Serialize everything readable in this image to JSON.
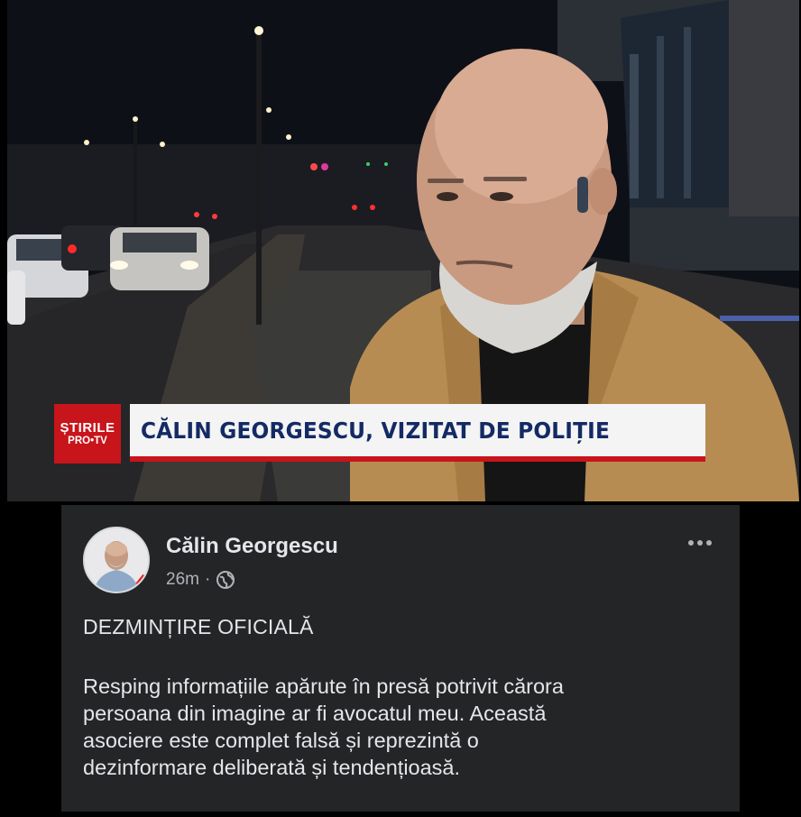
{
  "news": {
    "brand_line1": "ȘTIRILE",
    "brand_line2": "PRO•TV",
    "headline": "CĂLIN GEORGESCU, VIZITAT DE POLIȚIE",
    "brand_color": "#c8141b",
    "headline_color": "#142a64"
  },
  "post": {
    "author": "Călin Georgescu",
    "time": "26m",
    "separator": "·",
    "audience_icon": "globe-icon",
    "more_icon": "more-options-icon",
    "title": "DEZMINȚIRE OFICIALĂ",
    "body_lines": [
      "Resping informațiile apărute în presă potrivit cărora",
      "persoana din imagine ar fi avocatul meu. Această",
      "asociere este complet falsă și reprezintă o",
      "dezinformare deliberată și tendențioasă."
    ],
    "background": "#242527"
  }
}
